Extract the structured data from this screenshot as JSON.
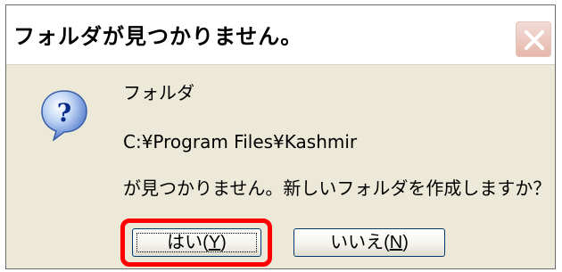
{
  "dialog": {
    "title": "フォルダが見つかりません。",
    "close_icon": "close-icon",
    "question_icon": "question-icon",
    "message": {
      "line1": "フォルダ",
      "path": "C:¥Program Files¥Kashmir",
      "line3": "が見つかりません。新しいフォルダを作成しますか？"
    },
    "buttons": {
      "yes_label_prefix": "はい(",
      "yes_accelerator": "Y",
      "yes_label_suffix": ")",
      "no_label_prefix": "いいえ(",
      "no_accelerator": "N",
      "no_label_suffix": ")"
    },
    "colors": {
      "highlight": "#ff0000",
      "close_button": "#e6b7aa",
      "face": "#ece9d8"
    }
  }
}
